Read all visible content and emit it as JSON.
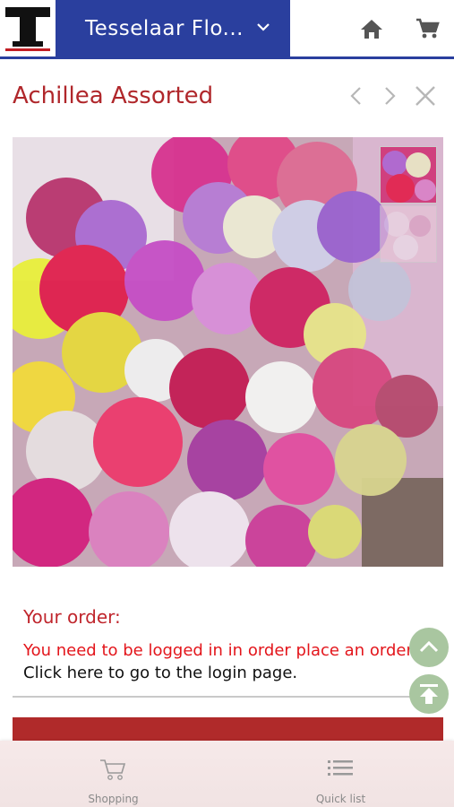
{
  "header": {
    "logo_letter": "T",
    "shop_name": "Tesselaar Flo...",
    "home_icon": "home-icon",
    "cart_icon": "cart-icon",
    "accent_color": "#2a3f9e"
  },
  "product": {
    "title": "Achillea Assorted",
    "prev_icon": "chevron-left-icon",
    "next_icon": "chevron-right-icon",
    "close_icon": "close-icon"
  },
  "order": {
    "title": "Your order:",
    "login_message": "You need to be logged in in order place an order.",
    "login_link": "Click here to go to the login page."
  },
  "floating": {
    "scroll_up_icon": "chevron-up-icon",
    "scroll_top_icon": "scroll-to-top-icon"
  },
  "bottom_nav": {
    "items": [
      {
        "label": "Shopping",
        "icon": "cart-icon"
      },
      {
        "label": "Quick list",
        "icon": "list-icon"
      }
    ]
  }
}
